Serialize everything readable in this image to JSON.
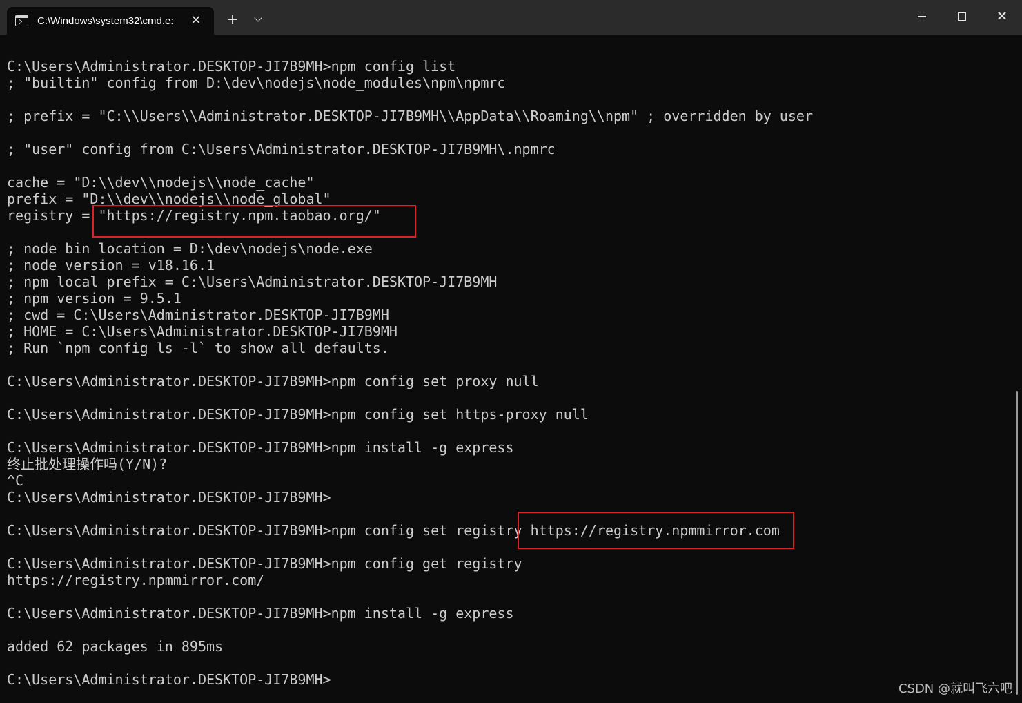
{
  "colors": {
    "terminal_background": "#0c0c0c",
    "terminal_text": "#cccccc",
    "titlebar": "#2b2b2b",
    "highlight_border": "#d9232a"
  },
  "titlebar": {
    "tab": {
      "title": "C:\\Windows\\system32\\cmd.e:",
      "icon": "terminal-icon",
      "close_glyph": "✕"
    },
    "new_tab_glyph": "+",
    "dropdown_icon": "chevron-down-icon",
    "window_controls": {
      "minimize_icon": "minimize-icon",
      "maximize_icon": "maximize-icon",
      "close_glyph": "✕"
    }
  },
  "terminal": {
    "lines": [
      "C:\\Users\\Administrator.DESKTOP-JI7B9MH>npm config list",
      "; \"builtin\" config from D:\\dev\\nodejs\\node_modules\\npm\\npmrc",
      "",
      "; prefix = \"C:\\\\Users\\\\Administrator.DESKTOP-JI7B9MH\\\\AppData\\\\Roaming\\\\npm\" ; overridden by user",
      "",
      "; \"user\" config from C:\\Users\\Administrator.DESKTOP-JI7B9MH\\.npmrc",
      "",
      "cache = \"D:\\\\dev\\\\nodejs\\\\node_cache\"",
      "prefix = \"D:\\\\dev\\\\nodejs\\\\node_global\"",
      "registry = \"https://registry.npm.taobao.org/\"",
      "",
      "; node bin location = D:\\dev\\nodejs\\node.exe",
      "; node version = v18.16.1",
      "; npm local prefix = C:\\Users\\Administrator.DESKTOP-JI7B9MH",
      "; npm version = 9.5.1",
      "; cwd = C:\\Users\\Administrator.DESKTOP-JI7B9MH",
      "; HOME = C:\\Users\\Administrator.DESKTOP-JI7B9MH",
      "; Run `npm config ls -l` to show all defaults.",
      "",
      "C:\\Users\\Administrator.DESKTOP-JI7B9MH>npm config set proxy null",
      "",
      "C:\\Users\\Administrator.DESKTOP-JI7B9MH>npm config set https-proxy null",
      "",
      "C:\\Users\\Administrator.DESKTOP-JI7B9MH>npm install -g express",
      "终止批处理操作吗(Y/N)?",
      "^C",
      "C:\\Users\\Administrator.DESKTOP-JI7B9MH>",
      "",
      "C:\\Users\\Administrator.DESKTOP-JI7B9MH>npm config set registry https://registry.npmmirror.com",
      "",
      "C:\\Users\\Administrator.DESKTOP-JI7B9MH>npm config get registry",
      "https://registry.npmmirror.com/",
      "",
      "C:\\Users\\Administrator.DESKTOP-JI7B9MH>npm install -g express",
      "",
      "added 62 packages in 895ms",
      "",
      "C:\\Users\\Administrator.DESKTOP-JI7B9MH>"
    ]
  },
  "watermark": "CSDN @就叫飞六吧"
}
